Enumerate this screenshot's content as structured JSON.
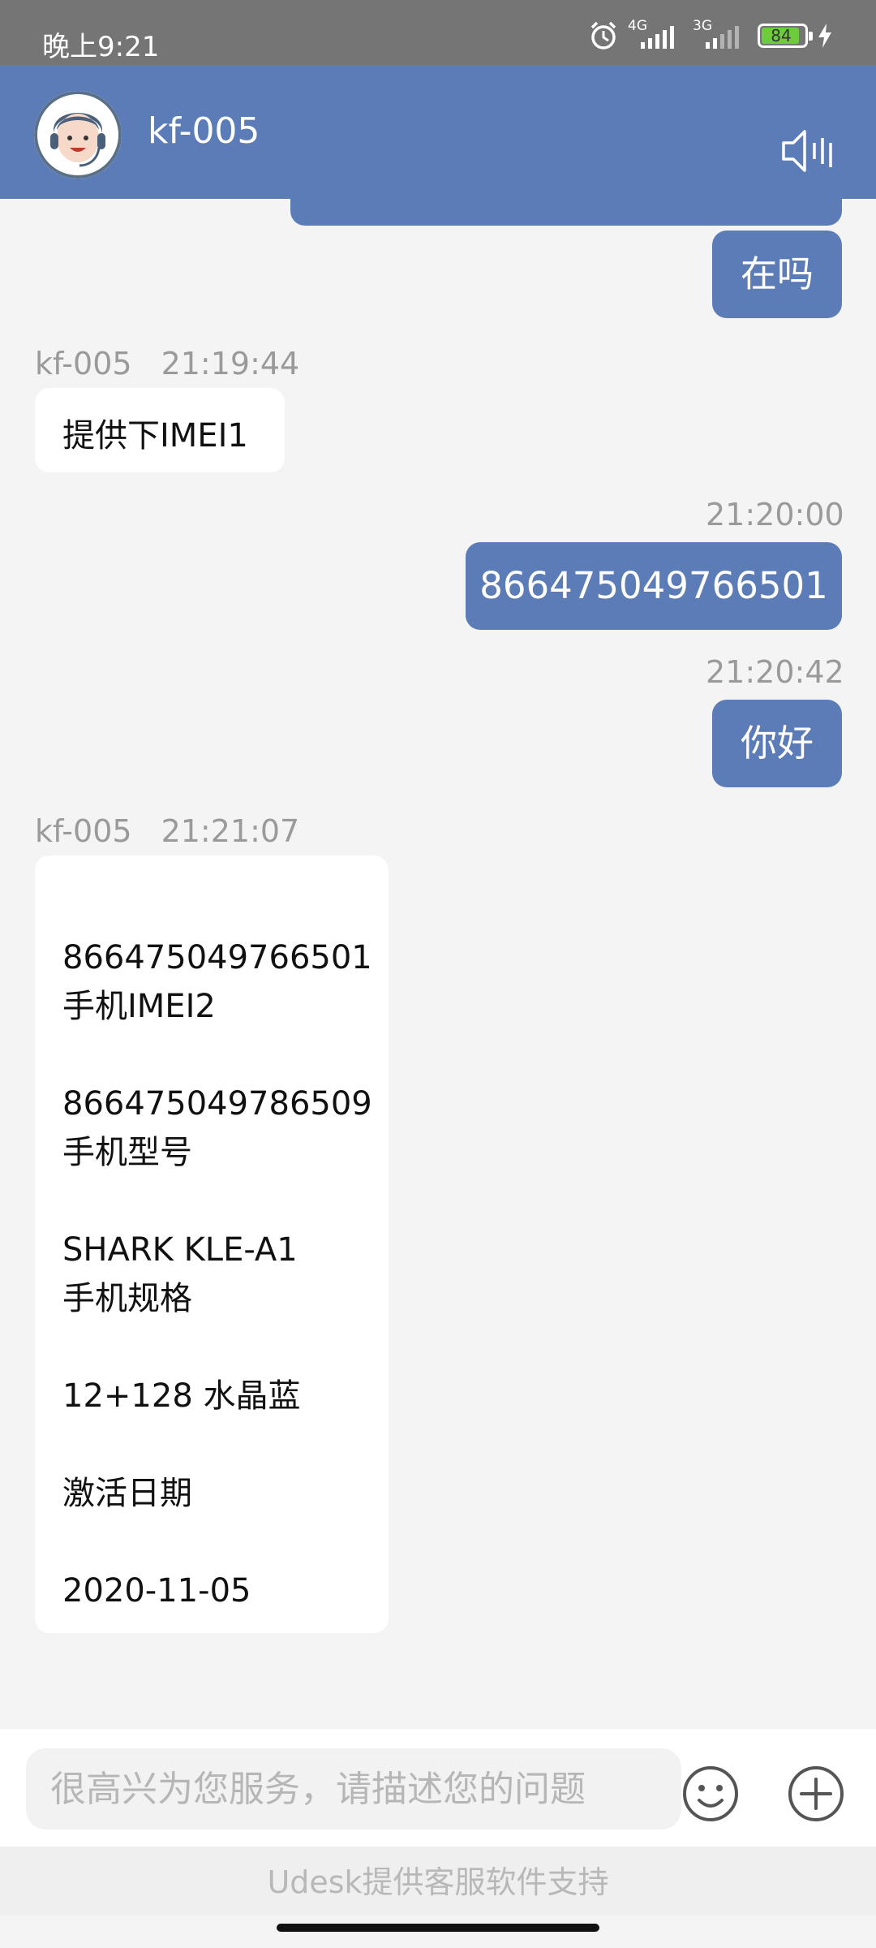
{
  "status": {
    "time": "晚上9:21",
    "net1": "4G",
    "net2": "3G",
    "battery": "84"
  },
  "header": {
    "agent_name": "kf-005"
  },
  "messages": {
    "m1": {
      "text": "在吗"
    },
    "m2": {
      "sender": "kf-005",
      "time": "21:19:44",
      "text": "提供下IMEI1"
    },
    "m3": {
      "time": "21:20:00",
      "text": "866475049766501"
    },
    "m4": {
      "time": "21:20:42",
      "text": "你好"
    },
    "m5": {
      "sender": "kf-005",
      "time": "21:21:07",
      "lines": [
        "",
        "866475049766501",
        "手机IMEI2",
        "",
        "866475049786509",
        "手机型号",
        "",
        "SHARK KLE-A1",
        "手机规格",
        "",
        "12+128 水晶蓝",
        "",
        "激活日期",
        "",
        "2020-11-05"
      ]
    }
  },
  "input": {
    "placeholder": "很高兴为您服务，请描述您的问题"
  },
  "footer": {
    "text": "Udesk提供客服软件支持"
  },
  "colors": {
    "brand": "#5c7cb8",
    "background": "#f4f4f4"
  }
}
